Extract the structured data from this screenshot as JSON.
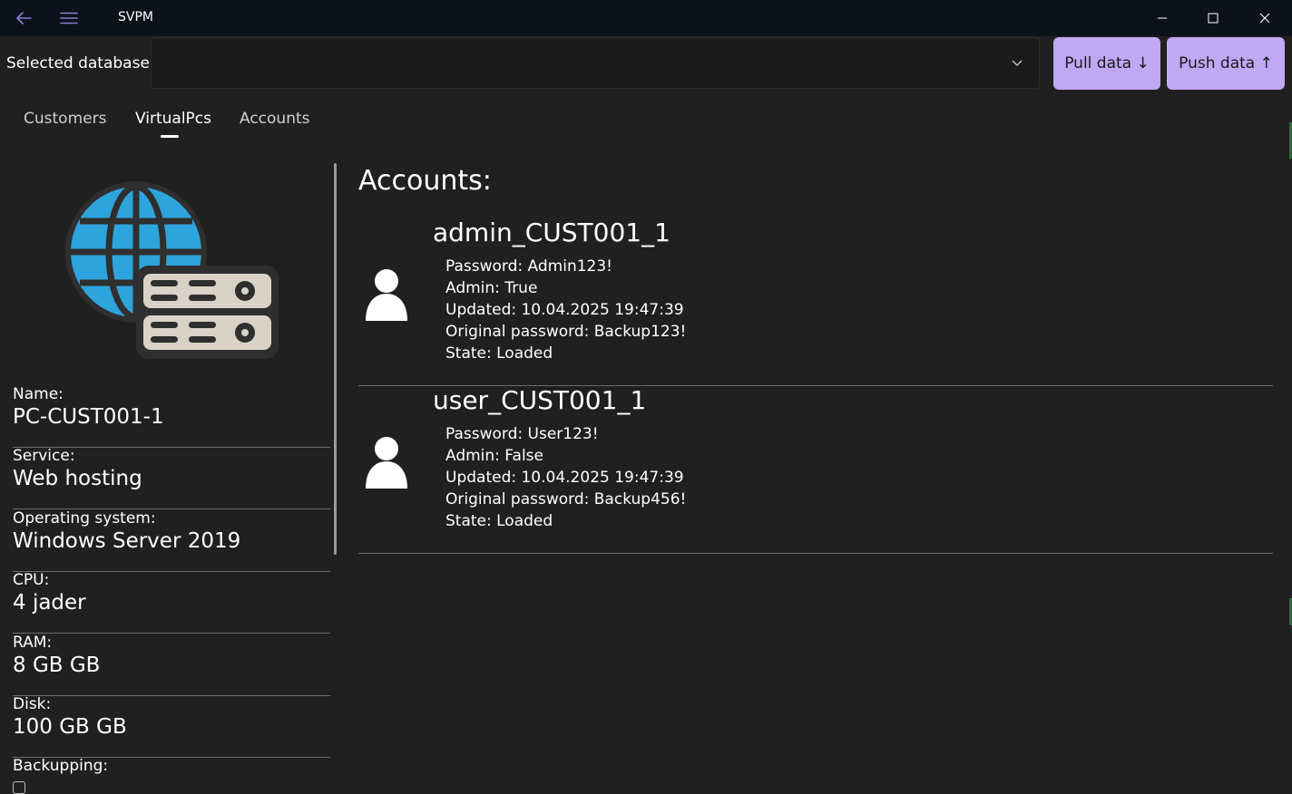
{
  "window": {
    "title": "SVPM",
    "back_icon": "back-arrow-icon",
    "menu_icon": "hamburger-menu-icon",
    "controls": [
      "minimize-icon",
      "maximize-icon",
      "close-icon"
    ],
    "accent_color": "#8a7bd8"
  },
  "toolbar": {
    "database_label": "Selected database:",
    "database_value": "",
    "pull_label": "Pull data ↓",
    "push_label": "Push data ↑",
    "button_color": "#c0a8f4"
  },
  "tabs": [
    {
      "label": "Customers",
      "active": false
    },
    {
      "label": "VirtualPcs",
      "active": true
    },
    {
      "label": "Accounts",
      "active": false
    }
  ],
  "pc": {
    "icon": "globe-server-icon",
    "fields": [
      {
        "label": "Name:",
        "value": "PC-CUST001-1"
      },
      {
        "label": "Service:",
        "value": "Web hosting"
      },
      {
        "label": "Operating system:",
        "value": "Windows Server 2019"
      },
      {
        "label": "CPU:",
        "value": "4 jader"
      },
      {
        "label": "RAM:",
        "value": "8 GB GB"
      },
      {
        "label": "Disk:",
        "value": "100 GB GB"
      },
      {
        "label": "Backupping:",
        "value": ""
      }
    ]
  },
  "accounts": {
    "heading": "Accounts:",
    "items": [
      {
        "name": "admin_CUST001_1",
        "password": "Password: Admin123!",
        "admin": "Admin: True",
        "updated": "Updated: 10.04.2025 19:47:39",
        "original_password": "Original password: Backup123!",
        "state": "State: Loaded",
        "icon": "user-avatar-icon"
      },
      {
        "name": "user_CUST001_1",
        "password": "Password: User123!",
        "admin": "Admin: False",
        "updated": "Updated: 10.04.2025 19:47:39",
        "original_password": "Original password: Backup456!",
        "state": "State: Loaded",
        "icon": "user-avatar-icon"
      }
    ]
  }
}
